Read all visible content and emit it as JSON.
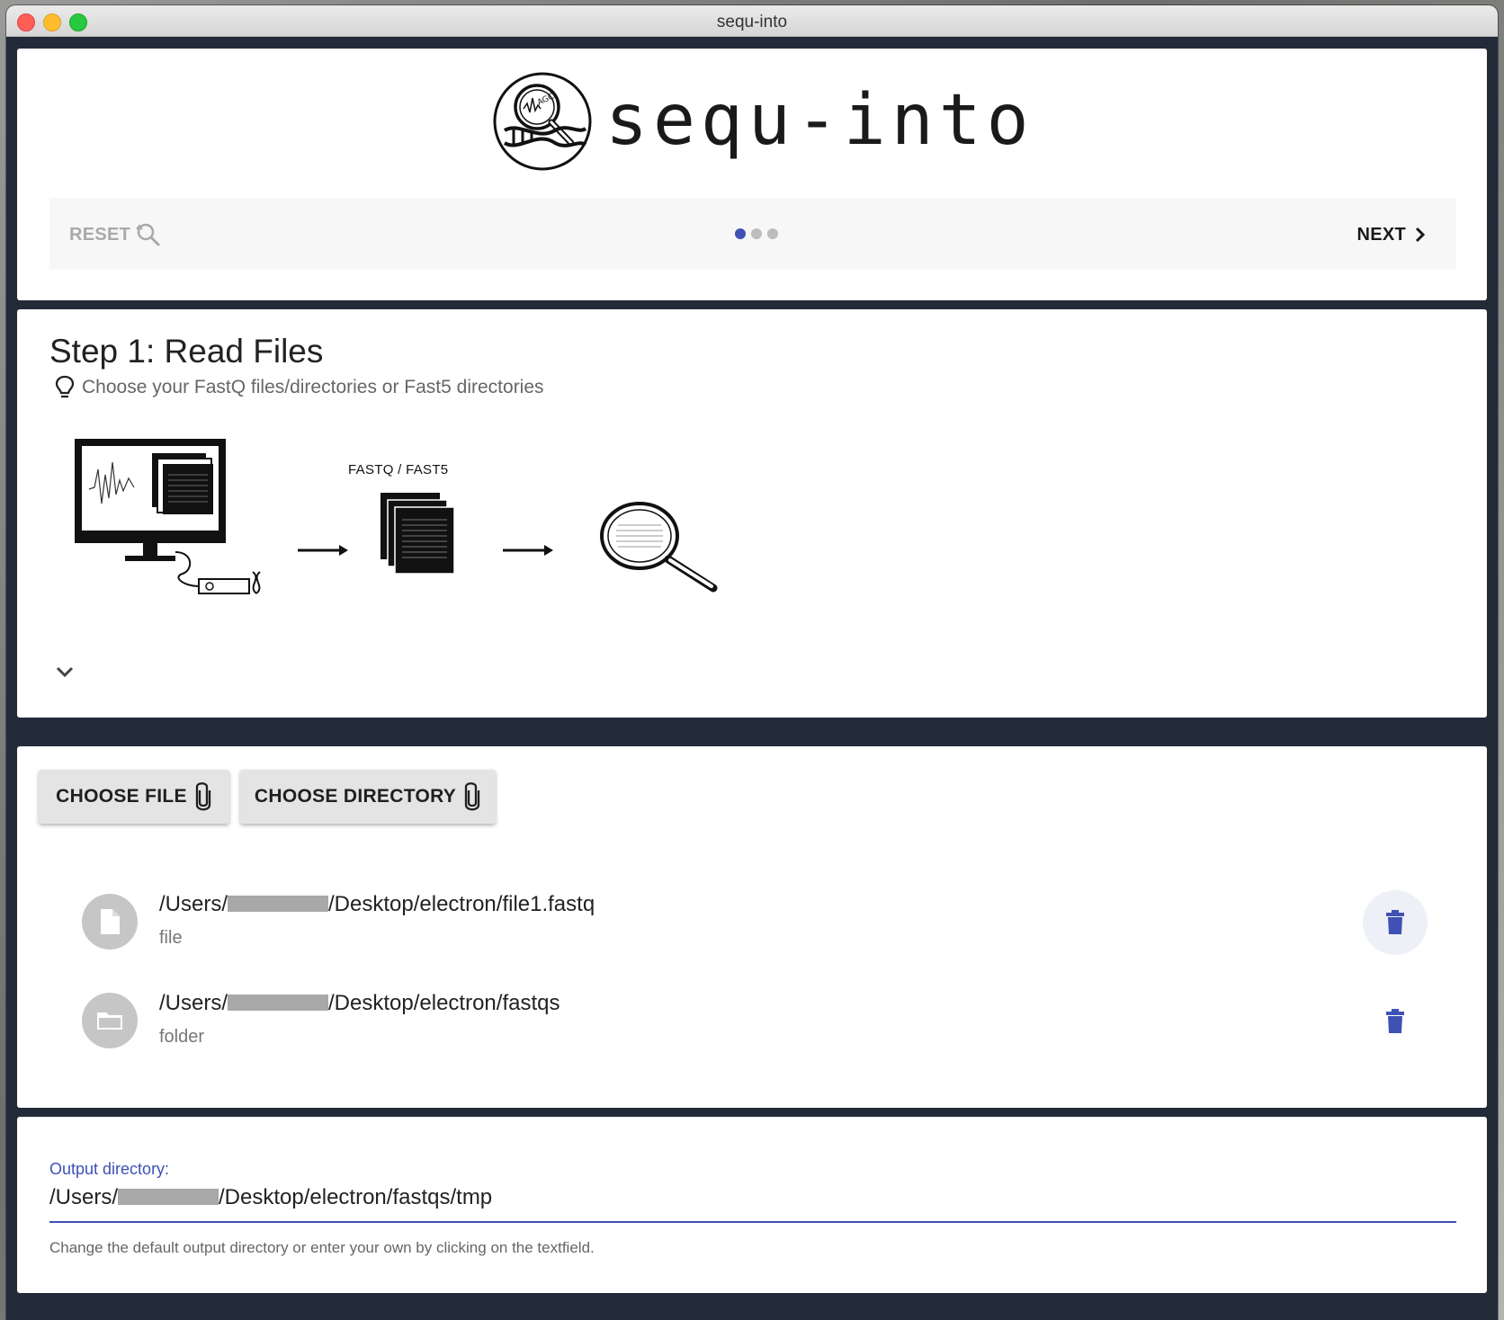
{
  "window": {
    "title": "sequ-into"
  },
  "header": {
    "logo_text": "sequ-into",
    "reset_label": "RESET",
    "next_label": "NEXT",
    "step_dots": 3,
    "active_step": 1
  },
  "step": {
    "title": "Step 1: Read Files",
    "hint": "Choose your FastQ files/directories or Fast5 directories",
    "illustration_label": "FASTQ / FAST5"
  },
  "files": {
    "choose_file_label": "CHOOSE FILE",
    "choose_directory_label": "CHOOSE DIRECTORY",
    "items": [
      {
        "path_prefix": "/Users/",
        "path_suffix": "/Desktop/electron/file1.fastq",
        "type": "file",
        "icon": "file-icon"
      },
      {
        "path_prefix": "/Users/",
        "path_suffix": "/Desktop/electron/fastqs",
        "type": "folder",
        "icon": "folder-icon"
      }
    ]
  },
  "output": {
    "label": "Output directory:",
    "value_prefix": "/Users/",
    "value_suffix": "/Desktop/electron/fastqs/tmp",
    "helper": "Change the default output directory or enter your own by clicking on the textfield."
  },
  "colors": {
    "accent": "#3f51b5",
    "window_bg": "#232a38",
    "card_bg": "#ffffff"
  }
}
